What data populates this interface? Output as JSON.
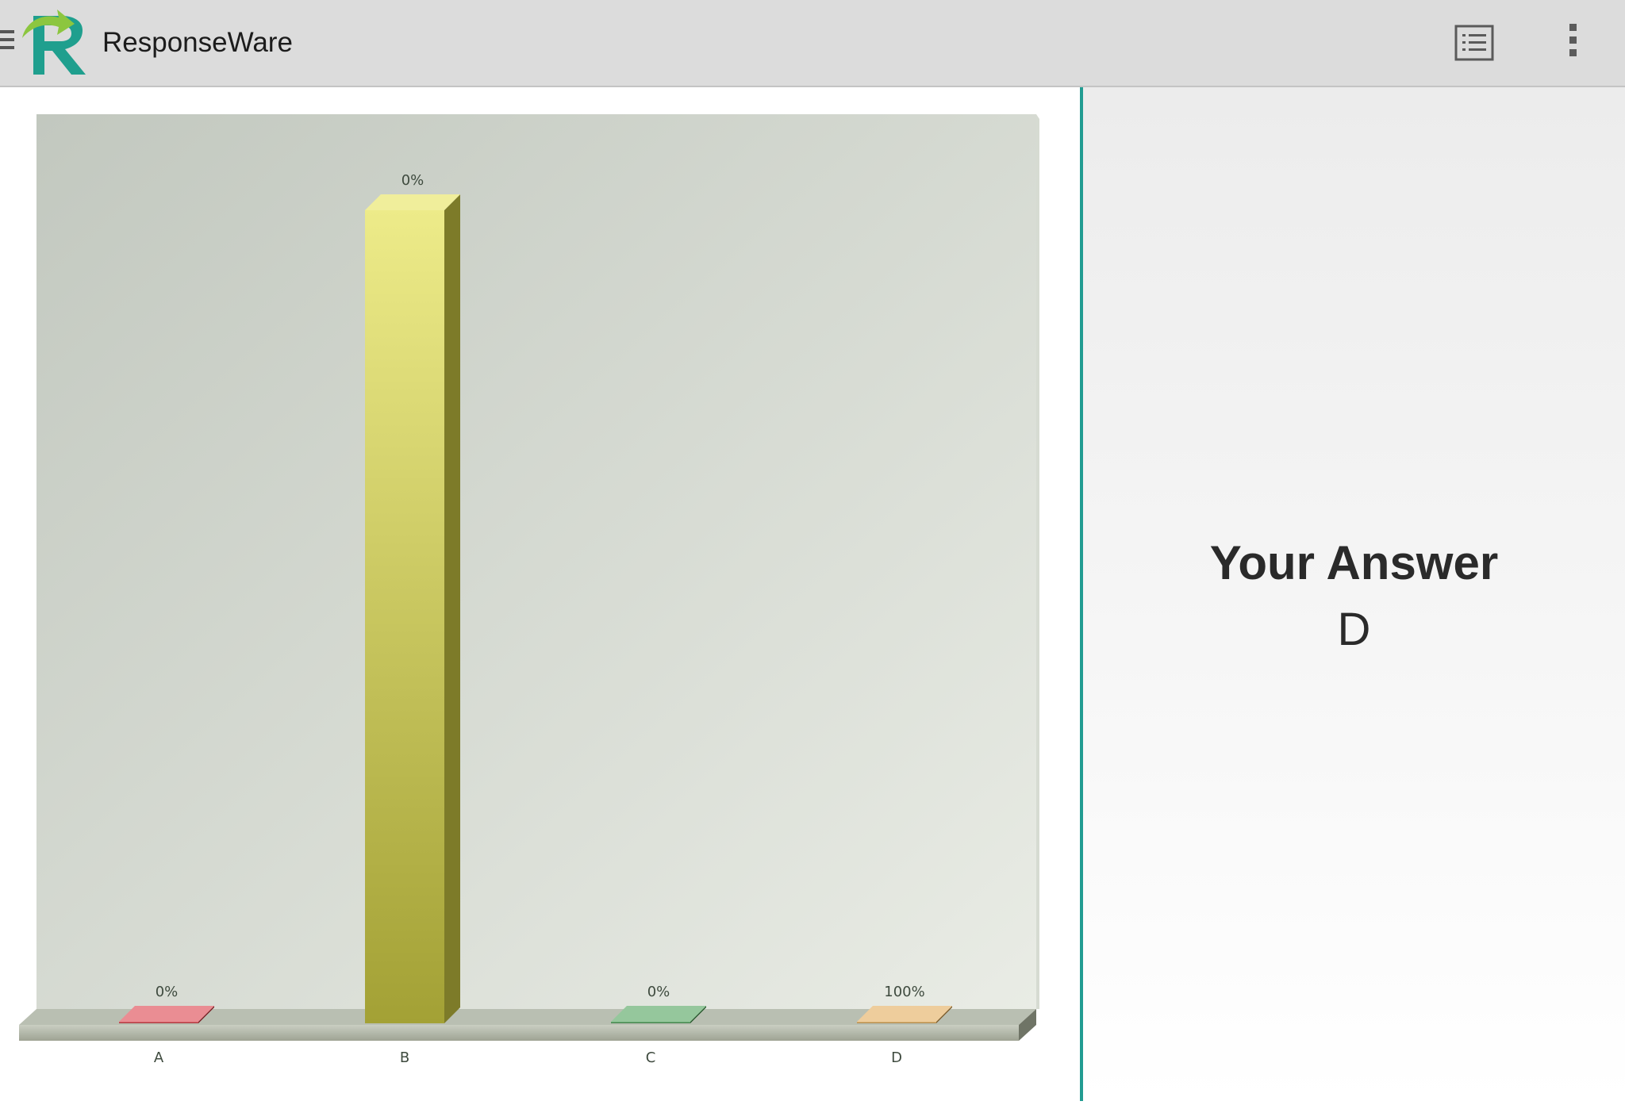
{
  "app": {
    "title": "ResponseWare"
  },
  "icons": {
    "menu": "hamburger-menu-icon",
    "logo": "responseware-logo-icon",
    "list": "list-view-icon",
    "more": "more-vert-icon"
  },
  "answer": {
    "title": "Your Answer",
    "value": "D"
  },
  "colors": {
    "accent": "#229c92",
    "bar_a": "#d8303a",
    "bar_b": "#e3e04a",
    "bar_c": "#3f9a4b",
    "bar_d": "#e0a44b"
  },
  "chart_data": {
    "type": "bar",
    "categories": [
      "A",
      "B",
      "C",
      "D"
    ],
    "values": [
      0,
      100,
      0,
      0
    ],
    "labels": [
      "0%",
      "0%",
      "0%",
      "100%"
    ],
    "unit": "%",
    "ylim": [
      0,
      100
    ],
    "grid": false,
    "legend": "none",
    "colors": [
      "#d8303a",
      "#e3e04a",
      "#3f9a4b",
      "#e0a44b"
    ]
  }
}
